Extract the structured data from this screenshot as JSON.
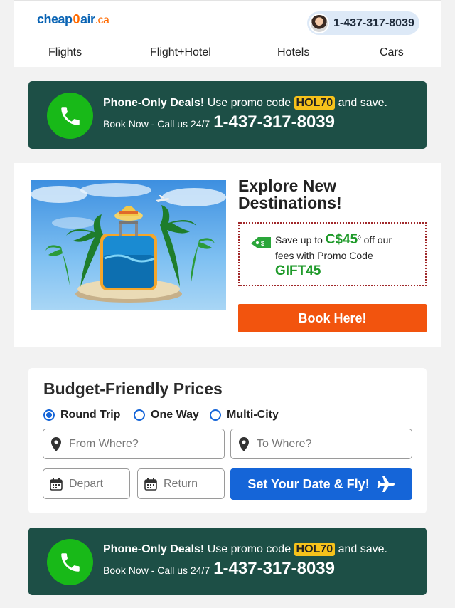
{
  "header": {
    "logo": {
      "part1": "cheap",
      "part2": "0",
      "part3": "air",
      "part4": ".ca"
    },
    "phone": "1-437-317-8039",
    "nav": [
      "Flights",
      "Flight+Hotel",
      "Hotels",
      "Cars"
    ]
  },
  "deal_banner": {
    "headline": "Phone-Only Deals!",
    "text_before": "Use promo code",
    "promo_code": "HOL70",
    "text_after": "and save.",
    "book_text": "Book Now - Call us 24/7",
    "phone": "1-437-317-8039"
  },
  "explore": {
    "title": "Explore New Destinations!",
    "save_prefix": "Save up to",
    "amount": "C$45",
    "dagger": "◊",
    "save_suffix": "off our",
    "line2": "fees with Promo Code",
    "code": "GIFT45",
    "button": "Book Here!"
  },
  "budget": {
    "title": "Budget-Friendly Prices",
    "trip_types": [
      {
        "label": "Round Trip",
        "selected": true
      },
      {
        "label": "One Way",
        "selected": false
      },
      {
        "label": "Multi-City",
        "selected": false
      }
    ],
    "from_placeholder": "From Where?",
    "to_placeholder": "To Where?",
    "depart_placeholder": "Depart",
    "return_placeholder": "Return",
    "submit": "Set Your Date & Fly!"
  },
  "colors": {
    "banner_bg": "#1d4f46",
    "phone_circle": "#18b918",
    "promo_highlight": "#f6c21b",
    "cta_orange": "#f2540e",
    "primary_blue": "#1565d8",
    "coupon_green": "#1f9a2a"
  }
}
